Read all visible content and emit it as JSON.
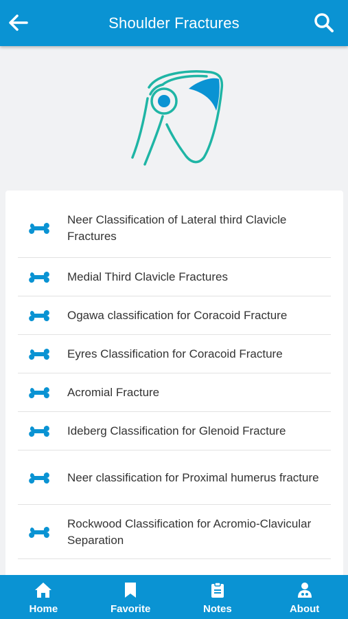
{
  "header": {
    "title": "Shoulder Fractures",
    "back_icon": "arrow-left-icon",
    "search_icon": "search-icon"
  },
  "hero": {
    "icon": "shoulder-joint-icon"
  },
  "list": {
    "items": [
      {
        "label": "Neer Classification of Lateral third Clavicle Fractures"
      },
      {
        "label": "Medial Third Clavicle Fractures"
      },
      {
        "label": "Ogawa classification for Coracoid Fracture"
      },
      {
        "label": "Eyres Classification for Coracoid Fracture"
      },
      {
        "label": "Acromial Fracture"
      },
      {
        "label": "Ideberg Classification for Glenoid Fracture"
      },
      {
        "label": "Neer classification for Proximal humerus fracture"
      },
      {
        "label": "Rockwood Classification for Acromio-Clavicular Separation"
      }
    ],
    "item_icon": "bone-icon"
  },
  "bottom_nav": {
    "tabs": [
      {
        "label": "Home",
        "icon": "home-icon"
      },
      {
        "label": "Favorite",
        "icon": "bookmark-icon"
      },
      {
        "label": "Notes",
        "icon": "clipboard-icon"
      },
      {
        "label": "About",
        "icon": "doctor-icon"
      }
    ]
  },
  "colors": {
    "primary": "#0a93d3",
    "teal": "#1fb5a5",
    "background": "#f1f2f4"
  }
}
